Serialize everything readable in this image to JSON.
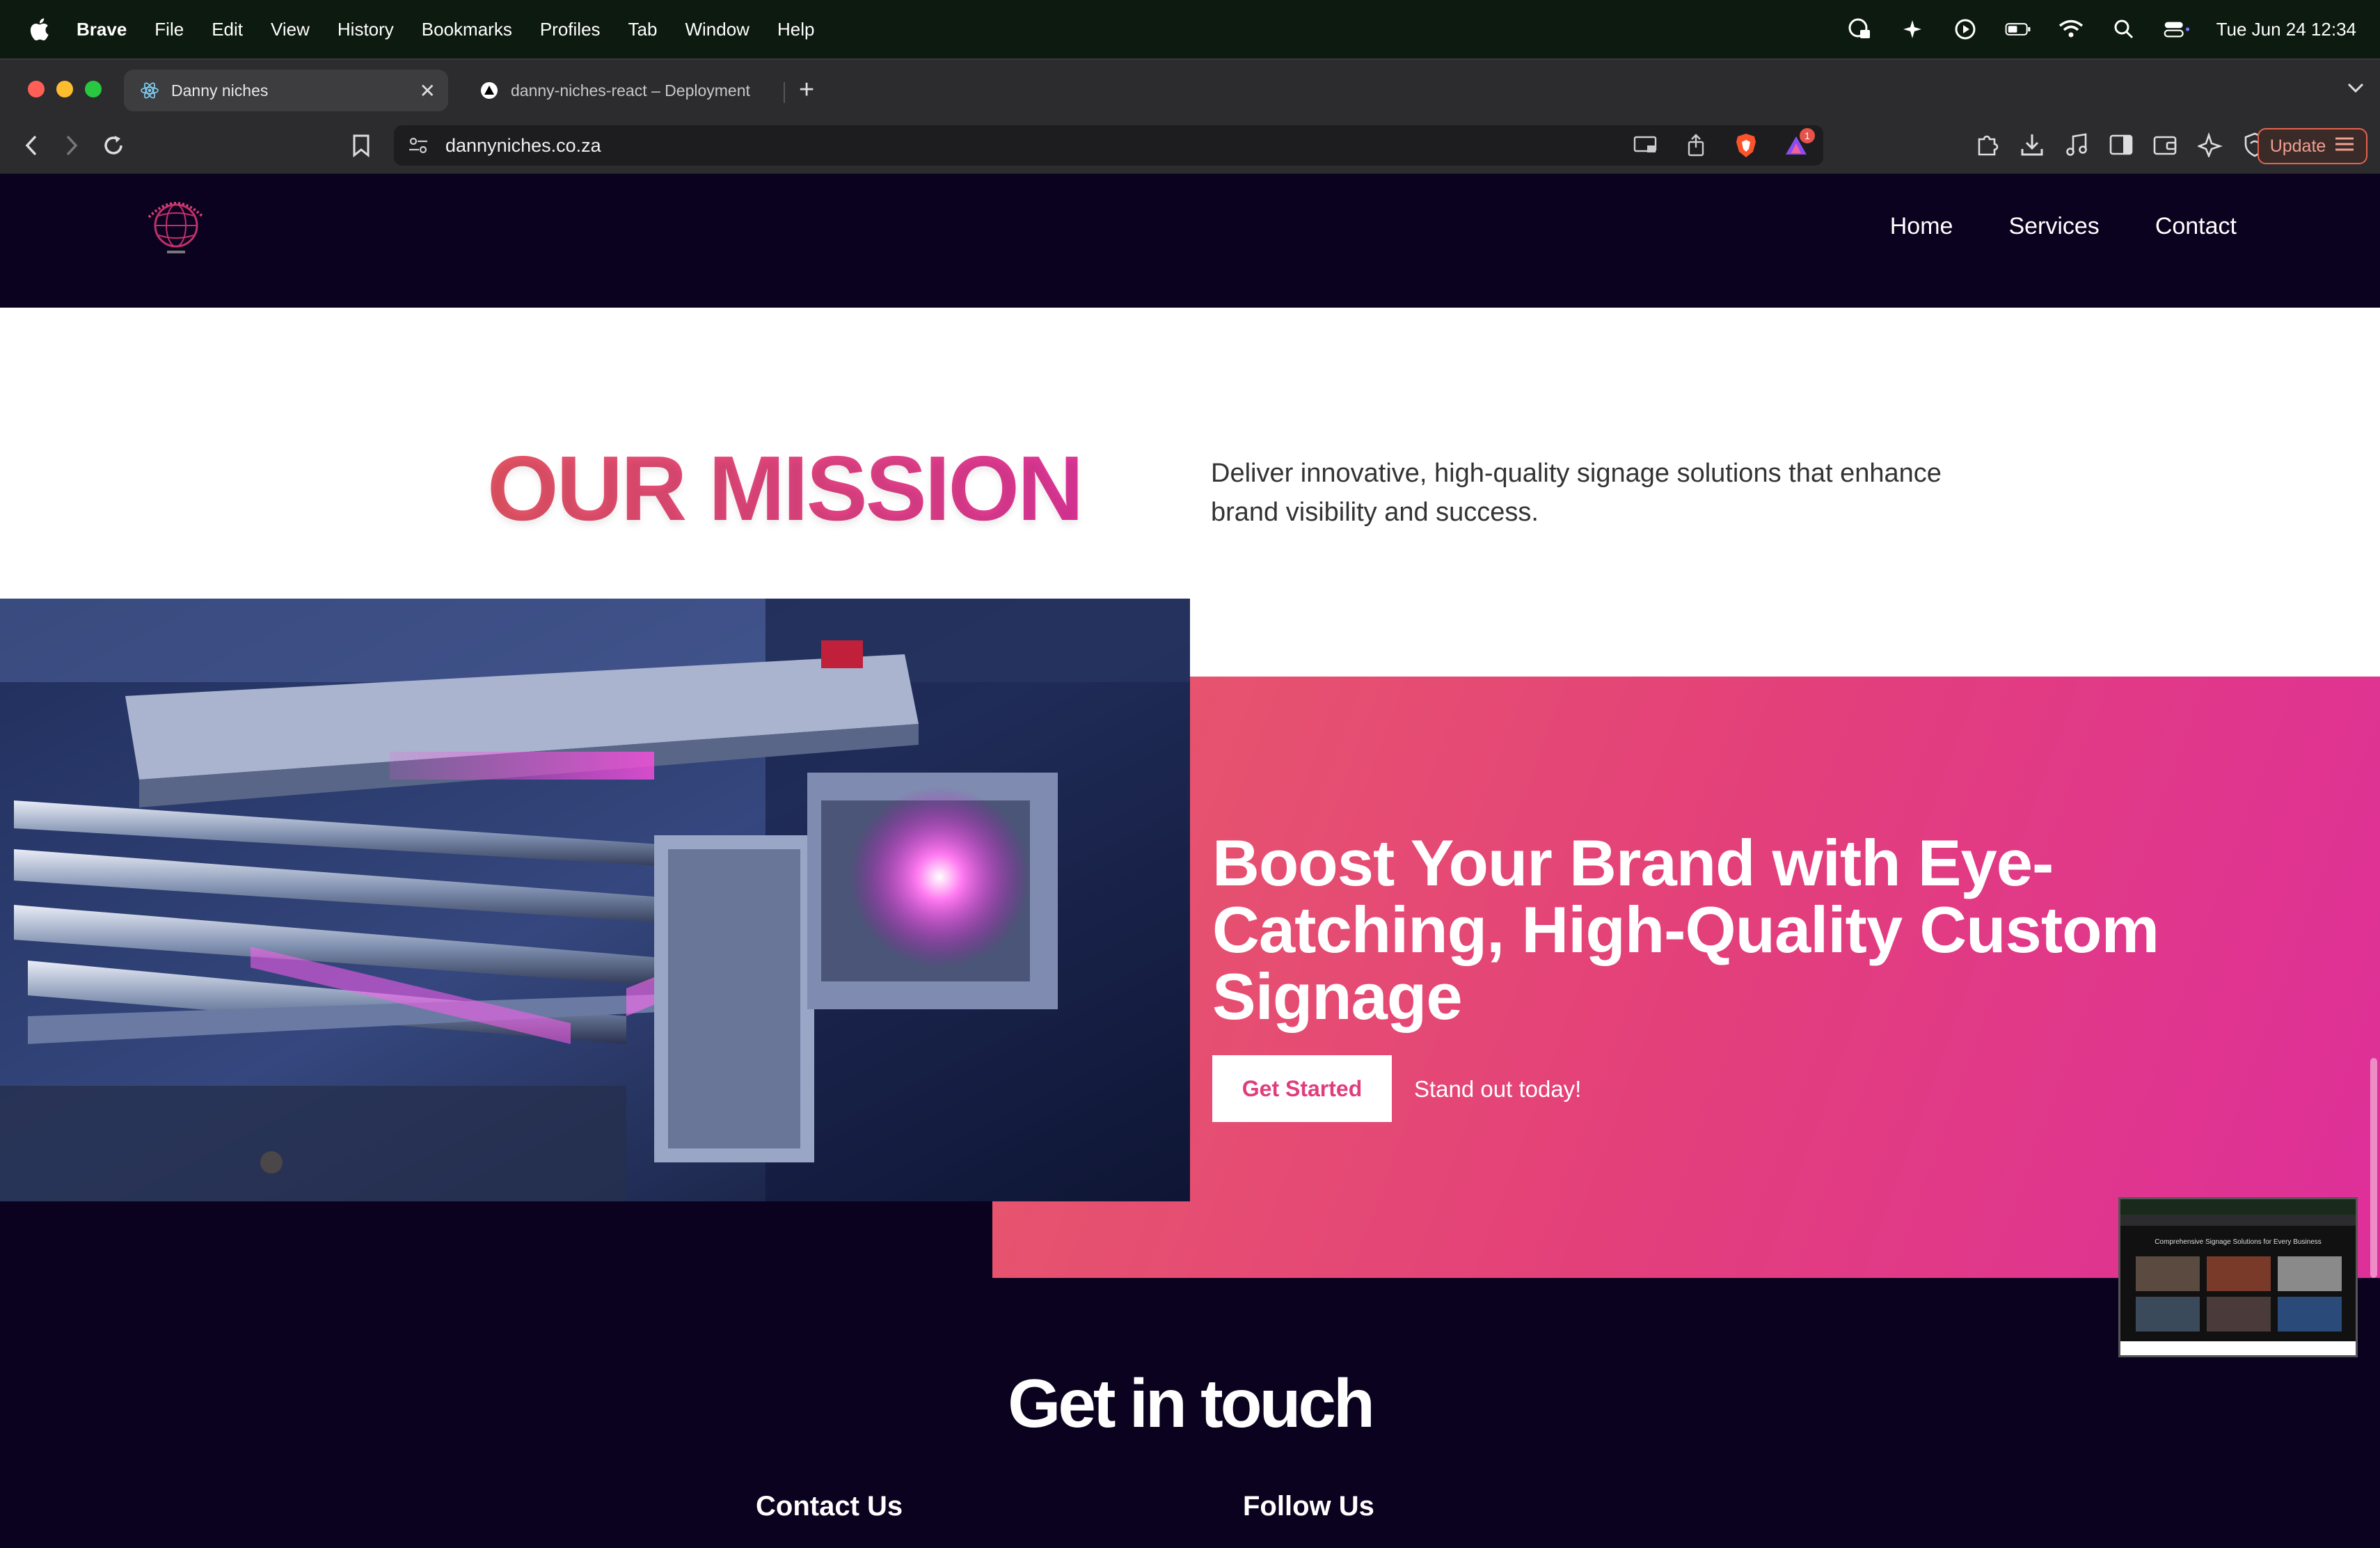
{
  "menubar": {
    "app_name": "Brave",
    "items": [
      "File",
      "Edit",
      "View",
      "History",
      "Bookmarks",
      "Profiles",
      "Tab",
      "Window",
      "Help"
    ],
    "clock": "Tue Jun 24  12:34"
  },
  "browser": {
    "tabs": [
      {
        "title": "Danny niches",
        "active": true
      },
      {
        "title": "danny-niches-react – Deployment",
        "active": false
      }
    ],
    "url": "dannyniches.co.za",
    "update_label": "Update",
    "notification_count": "1"
  },
  "site": {
    "nav": [
      "Home",
      "Services",
      "Contact"
    ],
    "mission": {
      "title": "OUR MISSION",
      "text": "Deliver innovative, high-quality signage solutions that enhance brand visibility and success."
    },
    "hero": {
      "title": "Boost Your Brand with Eye-Catching, High-Quality Custom Signage",
      "cta_label": "Get Started",
      "cta_sub": "Stand out today!"
    },
    "contact": {
      "title": "Get in touch",
      "col1": "Contact Us",
      "col2": "Follow Us"
    },
    "pip_caption": "Comprehensive Signage Solutions for Every Business"
  },
  "colors": {
    "brand_dark": "#0b021f",
    "brand_pink": "#e0369a",
    "brand_coral": "#e85a6a"
  }
}
